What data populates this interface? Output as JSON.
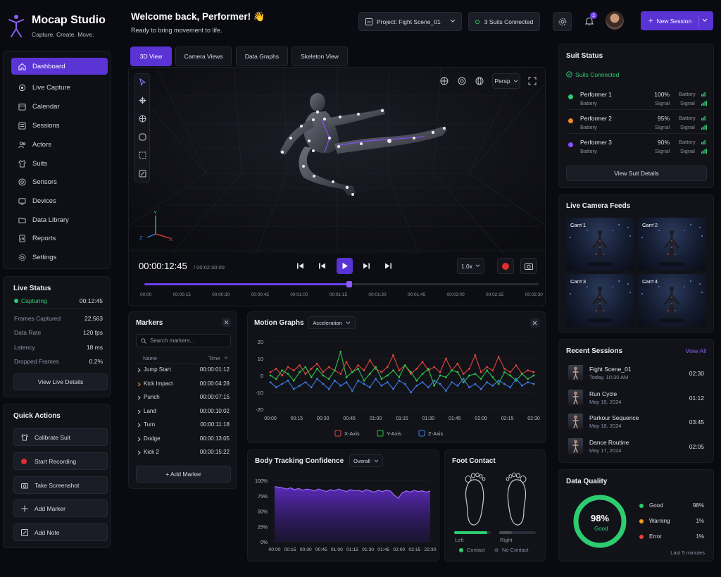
{
  "brand": {
    "title": "Mocap Studio",
    "tagline": "Capture. Create. Move."
  },
  "header": {
    "welcome": "Welcome back, Performer! 👋",
    "subtitle": "Ready to bring movement to life.",
    "project": "Project: Fight Scene_01",
    "suits": "3 Suits Connected",
    "notifications": "2",
    "new_session": "New Session"
  },
  "nav": [
    {
      "label": "Dashboard",
      "icon": "home-icon"
    },
    {
      "label": "Live Capture",
      "icon": "capture-icon"
    },
    {
      "label": "Calendar",
      "icon": "calendar-icon"
    },
    {
      "label": "Sessions",
      "icon": "sessions-icon"
    },
    {
      "label": "Actors",
      "icon": "actors-icon"
    },
    {
      "label": "Suits",
      "icon": "suit-icon"
    },
    {
      "label": "Sensors",
      "icon": "sensor-icon"
    },
    {
      "label": "Devices",
      "icon": "device-icon"
    },
    {
      "label": "Data Library",
      "icon": "library-icon"
    },
    {
      "label": "Reports",
      "icon": "reports-icon"
    },
    {
      "label": "Settings",
      "icon": "settings-icon"
    }
  ],
  "live_status": {
    "title": "Live Status",
    "status": "Capturing",
    "time": "00:12:45",
    "rows": [
      {
        "label": "Frames Captured",
        "value": "22,563"
      },
      {
        "label": "Data Rate",
        "value": "120 fps"
      },
      {
        "label": "Latency",
        "value": "18 ms"
      },
      {
        "label": "Dropped Frames",
        "value": "0.2%"
      }
    ],
    "button": "View Live Details"
  },
  "quick_actions": {
    "title": "Quick Actions",
    "items": [
      "Calibrate Suit",
      "Start Recording",
      "Take Screenshot",
      "Add Marker",
      "Add Note"
    ]
  },
  "viewer": {
    "tabs": [
      "3D View",
      "Camera Views",
      "Data Graphs",
      "Skeleton View"
    ],
    "projection": "Persp",
    "axes": {
      "x": "X",
      "y": "Y",
      "z": "Z"
    },
    "timecode": "00:00:12:45",
    "duration": "/ 00:02:30:00",
    "speed": "1.0x",
    "progress": 0.52,
    "ticks": [
      "00:00",
      "00:00:15",
      "00:00:30",
      "00:00:45",
      "00:01:00",
      "00:01:15",
      "00:01:30",
      "00:01:45",
      "00:02:00",
      "00:02:15",
      "00:02:30"
    ]
  },
  "suit_status": {
    "title": "Suit Status",
    "connected": "Suits Connected",
    "performers": [
      {
        "name": "Performer 1",
        "color": "#2ecc71",
        "battery_label": "Battery",
        "battery": "100%",
        "signal_label": "Signal",
        "signal": "Signal"
      },
      {
        "name": "Performer 2",
        "color": "#f08a24",
        "battery_label": "Battery",
        "battery": "95%",
        "signal_label": "Signal",
        "signal": "Signal"
      },
      {
        "name": "Performer 3",
        "color": "#8b4dff",
        "battery_label": "Battery",
        "battery": "90%",
        "signal_label": "Signal",
        "signal": "Signal"
      }
    ],
    "battery_word": "Battery",
    "button": "View Suit Details"
  },
  "camera_feeds": {
    "title": "Live Camera Feeds",
    "cams": [
      "Cam 1",
      "Cam 2",
      "Cam 3",
      "Cam 4"
    ]
  },
  "markers": {
    "title": "Markers",
    "search_placeholder": "Search markers...",
    "col_name": "Name",
    "col_time": "Time",
    "items": [
      {
        "name": "Jump Start",
        "time": "00:00:01:12"
      },
      {
        "name": "Kick Impact",
        "time": "00:00:04:28"
      },
      {
        "name": "Punch",
        "time": "00:00:07:15"
      },
      {
        "name": "Land",
        "time": "00:00:10:02"
      },
      {
        "name": "Turn",
        "time": "00:00:11:18"
      },
      {
        "name": "Dodge",
        "time": "00:00:13:05"
      },
      {
        "name": "Kick 2",
        "time": "00:00:15:22"
      }
    ],
    "add": "+ Add Marker"
  },
  "motion_graphs": {
    "title": "Motion Graphs",
    "dropdown": "Acceleration",
    "legend": [
      "X-Axis",
      "Y-Axis",
      "Z-Axis"
    ],
    "yticks": [
      "20",
      "10",
      "0",
      "-10",
      "-20"
    ],
    "xticks": [
      "00:00",
      "00:15",
      "00:30",
      "00:45",
      "01:00",
      "01:15",
      "01:30",
      "01:45",
      "02:00",
      "02:15",
      "02:30"
    ]
  },
  "confidence": {
    "title": "Body Tracking Confidence",
    "dropdown": "Overall",
    "yticks": [
      "100%",
      "75%",
      "50%",
      "25%",
      "0%"
    ],
    "xticks": [
      "00:00",
      "00:15",
      "00:30",
      "00:45",
      "01:00",
      "01:15",
      "01:30",
      "01:45",
      "02:00",
      "02:15",
      "22:30"
    ]
  },
  "foot": {
    "title": "Foot Contact",
    "left": "Left",
    "right": "Right",
    "contact": "Contact",
    "no_contact": "No Contact",
    "left_level": 0.9,
    "right_level": 0.35
  },
  "recent": {
    "title": "Recent Sessions",
    "view_all": "View All",
    "items": [
      {
        "name": "Fight Scene_01",
        "date": "Today, 10:30 AM",
        "dur": "02:30"
      },
      {
        "name": "Run Cycle",
        "date": "May 19, 2024",
        "dur": "01:12"
      },
      {
        "name": "Parkour Sequence",
        "date": "May 18, 2024",
        "dur": "03:45"
      },
      {
        "name": "Dance Routine",
        "date": "May 17, 2024",
        "dur": "02:05"
      }
    ]
  },
  "quality": {
    "title": "Data Quality",
    "value": "98%",
    "label": "Good",
    "level": 0.98,
    "legend": [
      {
        "label": "Good",
        "value": "98%",
        "color": "#2ecc71"
      },
      {
        "label": "Warning",
        "value": "1%",
        "color": "#f0a020"
      },
      {
        "label": "Error",
        "value": "1%",
        "color": "#e84040"
      }
    ],
    "footer": "Last 5 minutes"
  },
  "chart_data": [
    {
      "type": "line",
      "title": "Motion Graphs",
      "ylim": [
        -20,
        20
      ],
      "x": [
        "00:00",
        "00:15",
        "00:30",
        "00:45",
        "01:00",
        "01:15",
        "01:30",
        "01:45",
        "02:00",
        "02:15",
        "02:30"
      ],
      "series": [
        {
          "name": "X-Axis",
          "color": "#e0443c",
          "values": [
            2,
            4,
            0,
            5,
            3,
            6,
            1,
            4,
            7,
            2,
            5,
            3,
            1,
            8,
            2,
            6,
            3,
            9,
            4,
            2,
            5,
            12,
            3,
            6,
            1,
            4,
            8,
            3,
            5,
            2,
            10,
            3,
            7,
            1,
            4,
            12,
            2,
            5,
            3,
            11,
            4,
            2,
            6,
            1,
            3,
            2
          ]
        },
        {
          "name": "Y-Axis",
          "color": "#2fbf4a",
          "values": [
            0,
            -2,
            3,
            1,
            -3,
            2,
            5,
            -1,
            4,
            0,
            -2,
            3,
            14,
            -1,
            2,
            4,
            -3,
            1,
            5,
            -2,
            0,
            3,
            -1,
            6,
            2,
            -3,
            1,
            4,
            -6,
            0,
            -1,
            3,
            2,
            -4,
            0,
            1,
            -2,
            3,
            -1,
            -5,
            2,
            0,
            -3,
            1,
            -2,
            0
          ]
        },
        {
          "name": "Z-Axis",
          "color": "#3b7be0",
          "values": [
            -4,
            -7,
            -5,
            -3,
            -8,
            -6,
            -4,
            -7,
            -2,
            -5,
            -8,
            -3,
            -6,
            -4,
            -9,
            -3,
            -5,
            -7,
            -2,
            -6,
            -4,
            -8,
            -3,
            -5,
            -10,
            -6,
            -4,
            -7,
            -3,
            -5,
            -9,
            -4,
            -6,
            -2,
            -7,
            -5,
            -8,
            -4,
            -6,
            -3,
            -5,
            -7,
            -2,
            -6,
            -4,
            -5
          ]
        }
      ]
    },
    {
      "type": "area",
      "title": "Body Tracking Confidence",
      "ylim": [
        0,
        100
      ],
      "x": [
        "00:00",
        "00:15",
        "00:30",
        "00:45",
        "01:00",
        "01:15",
        "01:30",
        "01:45",
        "02:00",
        "02:15",
        "22:30"
      ],
      "series": [
        {
          "name": "",
          "color": "#7b3fe4",
          "values": [
            90,
            89,
            88,
            86,
            88,
            85,
            87,
            84,
            86,
            85,
            83,
            86,
            84,
            82,
            85,
            83,
            86,
            84,
            82,
            85,
            83,
            84,
            82,
            85,
            83,
            81,
            84,
            82,
            84,
            83,
            76,
            71,
            80,
            83,
            81,
            84,
            82,
            83,
            81,
            83
          ]
        }
      ]
    }
  ]
}
